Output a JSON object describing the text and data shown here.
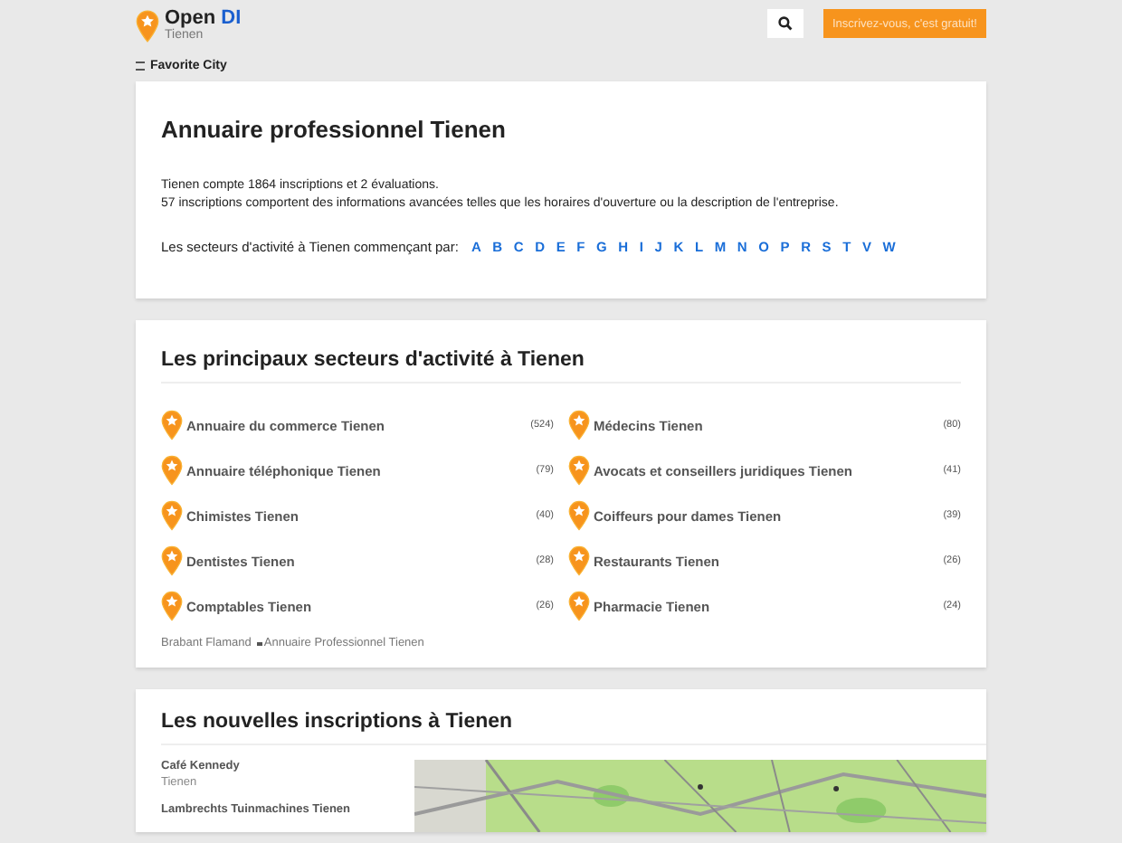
{
  "header": {
    "logo_text": "Open",
    "logo_accent": "DI",
    "city": "Tienen",
    "favorite": "Favorite City",
    "signup_button": "Inscrivez-vous, c'est gratuit!"
  },
  "intro": {
    "title": "Annuaire professionnel Tienen",
    "stats": "Tienen compte 1864 inscriptions et 2 évaluations.",
    "details": "57 inscriptions comportent des informations avancées telles que les horaires d'ouverture ou la description de l'entreprise.",
    "letters_label": "Les secteurs d'activité à Tienen commençant par:",
    "letters": [
      "A",
      "B",
      "C",
      "D",
      "E",
      "F",
      "G",
      "H",
      "I",
      "J",
      "K",
      "L",
      "M",
      "N",
      "O",
      "P",
      "R",
      "S",
      "T",
      "V",
      "W"
    ]
  },
  "sectors": {
    "title": "Les principaux secteurs d'activité à Tienen",
    "items": [
      {
        "name": "Annuaire du commerce Tienen",
        "count": "(524)"
      },
      {
        "name": "Médecins Tienen",
        "count": "(80)"
      },
      {
        "name": "Annuaire téléphonique Tienen",
        "count": "(79)"
      },
      {
        "name": "Avocats et conseillers juridiques Tienen",
        "count": "(41)"
      },
      {
        "name": "Chimistes Tienen",
        "count": "(40)"
      },
      {
        "name": "Coiffeurs pour dames Tienen",
        "count": "(39)"
      },
      {
        "name": "Dentistes Tienen",
        "count": "(28)"
      },
      {
        "name": "Restaurants Tienen",
        "count": "(26)"
      },
      {
        "name": "Comptables Tienen",
        "count": "(26)"
      },
      {
        "name": "Pharmacie Tienen",
        "count": "(24)"
      }
    ],
    "breadcrumb": [
      "Brabant Flamand",
      "Annuaire Professionnel Tienen"
    ]
  },
  "new_listings": {
    "title": "Les nouvelles inscriptions à Tienen",
    "items": [
      {
        "name": "Café Kennedy",
        "city": "Tienen"
      },
      {
        "name": "Lambrechts Tuinmachines Tienen"
      }
    ]
  }
}
